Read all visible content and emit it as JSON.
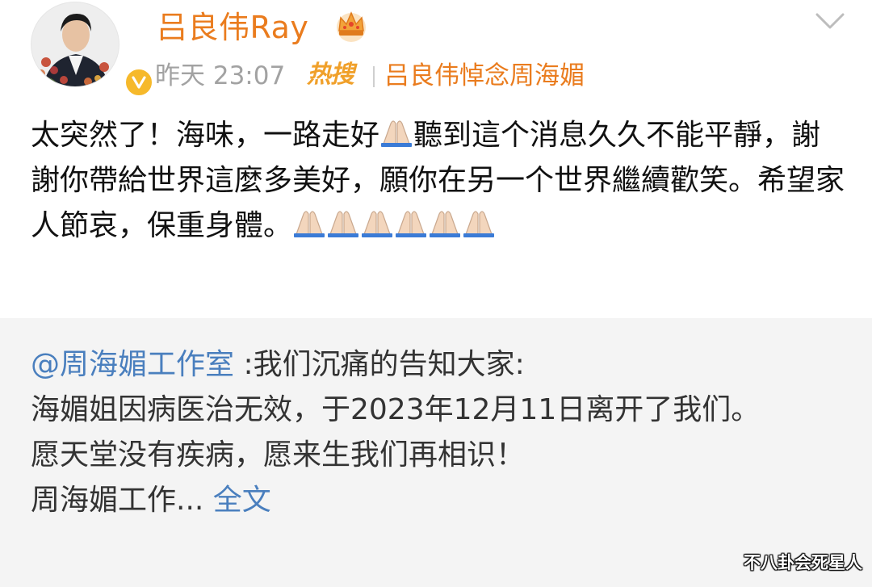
{
  "header": {
    "user_name": "吕良伟Ray",
    "time": "昨天 23:07",
    "hot_badge": "热搜",
    "hot_topic": "吕良伟悼念周海媚"
  },
  "post": {
    "text_1": "太突然了！海味，一路走好",
    "text_2": "聽到這个消息久久不能平靜，謝謝你帶給世界這麼多美好，願你在另一个世界繼續歡笑。希望家人節哀，保重身體。",
    "icon": "folded-hands-emoji"
  },
  "repost": {
    "mention": "@周海媚工作室",
    "lead": " :我们沉痛的告知大家:",
    "line_2": "海媚姐因病医治无效，于2023年12月11日离开了我们。",
    "line_3": "愿天堂没有疾病，愿来生我们再相识！",
    "line_4": "周海媚工作...",
    "full_text_link": "全文"
  },
  "watermark": "不八卦会死星人",
  "colors": {
    "orange": "#ea7c1e",
    "hot": "#f0a02a",
    "link_blue": "#4a7fbe",
    "gray_text": "#a2a2a2",
    "repost_bg": "#f4f4f4",
    "verified": "#f6b92b"
  }
}
